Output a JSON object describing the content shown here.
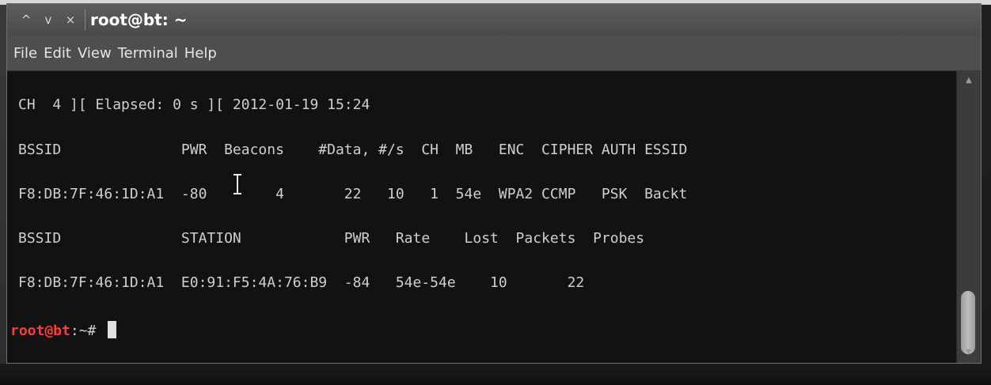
{
  "window": {
    "title": "root@bt: ~",
    "controls": {
      "minimize": "^",
      "maximize": "v",
      "close": "×"
    }
  },
  "menu": [
    "File",
    "Edit",
    "View",
    "Terminal",
    "Help"
  ],
  "terminal": {
    "lines": [
      "CH  4 ][ Elapsed: 0 s ][ 2012-01-19 15:24",
      "BSSID              PWR  Beacons    #Data, #/s  CH  MB   ENC  CIPHER AUTH ESSID",
      "F8:DB:7F:46:1D:A1  -80        4       22   10   1  54e  WPA2 CCMP   PSK  Backt",
      "BSSID              STATION            PWR   Rate    Lost  Packets  Probes",
      "F8:DB:7F:46:1D:A1  E0:91:F5:4A:76:B9  -84   54e-54e    10       22"
    ],
    "prompt_user": "root@bt",
    "prompt_rest": ":~# "
  },
  "colors": {
    "terminal_bg": "#121212",
    "terminal_fg": "#cfcfcf",
    "prompt_user": "#ff3b3b",
    "titlebar": "#5d5d5d"
  },
  "icons": [
    "minimize-icon",
    "maximize-icon",
    "close-icon",
    "text-cursor-icon",
    "scroll-up-icon",
    "scroll-down-icon"
  ]
}
